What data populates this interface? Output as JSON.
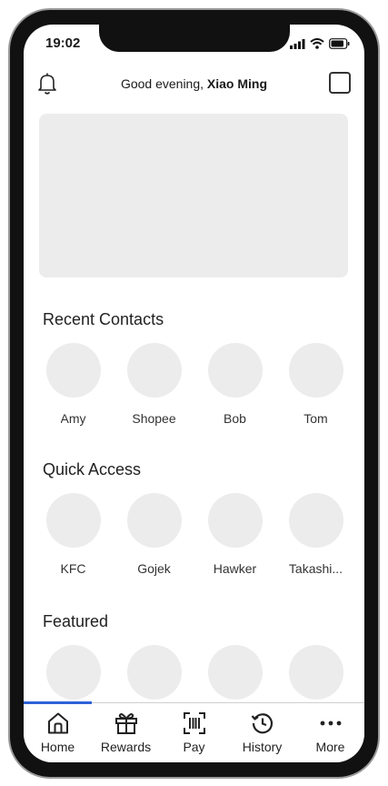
{
  "status": {
    "time": "19:02"
  },
  "header": {
    "greeting": "Good evening, ",
    "user_name": "Xiao Ming"
  },
  "sections": {
    "recent_contacts": {
      "title": "Recent Contacts",
      "items": [
        {
          "label": "Amy"
        },
        {
          "label": "Shopee"
        },
        {
          "label": "Bob"
        },
        {
          "label": "Tom"
        }
      ]
    },
    "quick_access": {
      "title": "Quick Access",
      "items": [
        {
          "label": "KFC"
        },
        {
          "label": "Gojek"
        },
        {
          "label": "Hawker"
        },
        {
          "label": "Takashi..."
        }
      ]
    },
    "featured": {
      "title": "Featured"
    }
  },
  "tabbar": {
    "items": [
      {
        "label": "Home",
        "icon": "home-icon",
        "active": true
      },
      {
        "label": "Rewards",
        "icon": "gift-icon"
      },
      {
        "label": "Pay",
        "icon": "scan-pay-icon"
      },
      {
        "label": "History",
        "icon": "history-icon"
      },
      {
        "label": "More",
        "icon": "more-icon"
      }
    ]
  },
  "colors": {
    "accent": "#2f62d8",
    "placeholder": "#ececec"
  }
}
